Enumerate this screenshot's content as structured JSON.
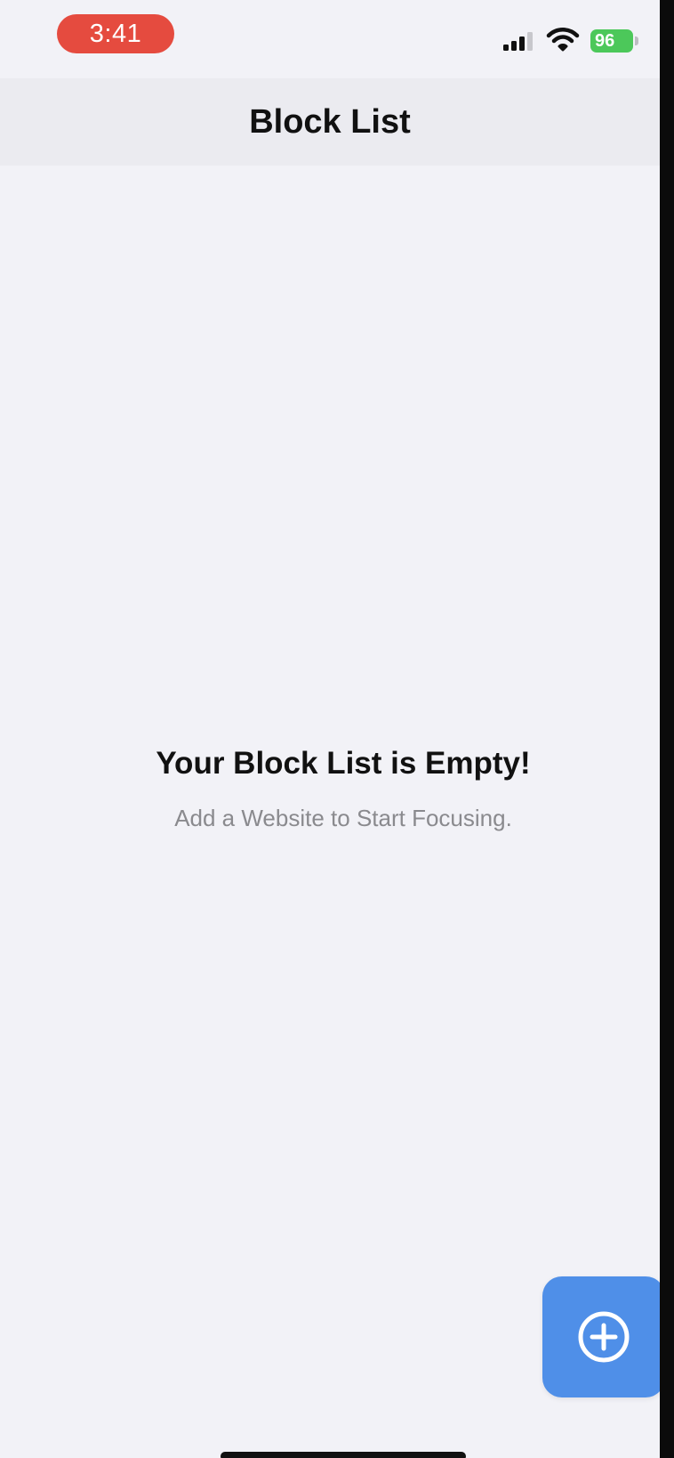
{
  "status_bar": {
    "time": "3:41",
    "battery_level": "96",
    "signal_icon": "cellular-signal-icon",
    "wifi_icon": "wifi-icon",
    "battery_icon": "battery-charging-icon"
  },
  "nav": {
    "title": "Block List"
  },
  "empty_state": {
    "title": "Your Block List is Empty!",
    "subtitle": "Add a Website to Start Focusing."
  },
  "fab": {
    "icon": "plus-circle-icon"
  },
  "colors": {
    "time_pill": "#e54b3f",
    "battery": "#4cc85a",
    "fab": "#4f8fe8",
    "background": "#f2f2f7"
  }
}
